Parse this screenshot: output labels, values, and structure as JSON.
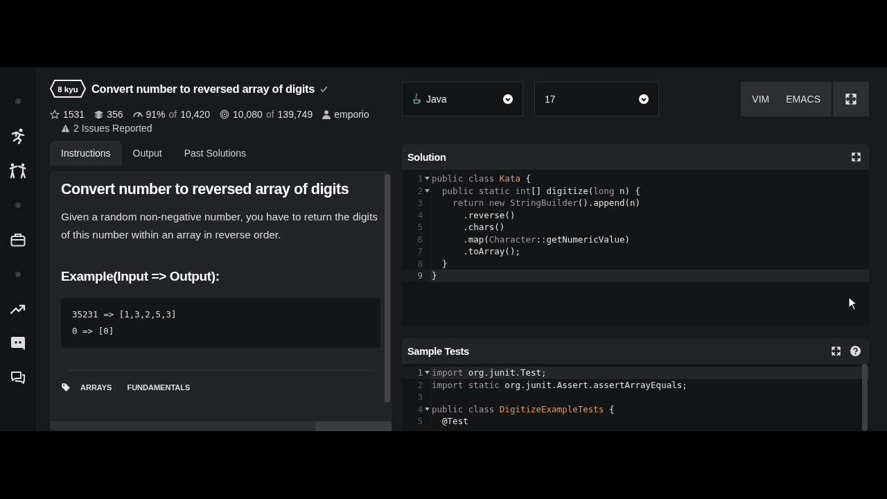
{
  "kata": {
    "rank": "8 kyu",
    "title": "Convert number to reversed array of digits",
    "completed": true,
    "stats": [
      {
        "kind": "stars",
        "text": "1531"
      },
      {
        "kind": "collections",
        "text": "356"
      },
      {
        "kind": "satisfaction",
        "text": "91%",
        "muted": "of",
        "total": "10,420"
      },
      {
        "kind": "completions",
        "text": "10,080",
        "muted": "of",
        "total": "139,749"
      },
      {
        "kind": "author",
        "text": "emporio"
      }
    ],
    "issues": "2 Issues Reported"
  },
  "tabs": [
    {
      "label": "Instructions",
      "selected": true
    },
    {
      "label": "Output",
      "selected": false
    },
    {
      "label": "Past Solutions",
      "selected": false
    }
  ],
  "description": {
    "heading": "Convert number to reversed array of digits",
    "paragraph": "Given a random non-negative number, you have to return the digits of this number within an array in reverse order.",
    "example_heading": "Example(Input => Output):",
    "example_lines": [
      "35231 => [1,3,2,5,3]",
      "0 => [0]"
    ],
    "tags": [
      "ARRAYS",
      "FUNDAMENTALS"
    ]
  },
  "toolbar": {
    "language": "Java",
    "version": "17",
    "modes": [
      "VIM",
      "EMACS"
    ]
  },
  "editors": [
    {
      "title": "Solution",
      "help": false,
      "lines": [
        {
          "number": "1",
          "foldable": true,
          "current": false,
          "tokens": [
            {
              "kind": "keyword",
              "text": "public class "
            },
            {
              "kind": "type",
              "text": "Kata"
            },
            {
              "kind": "plain",
              "text": " {"
            }
          ]
        },
        {
          "number": "2",
          "foldable": true,
          "current": false,
          "tokens": [
            {
              "kind": "keyword",
              "text": "  public static int"
            },
            {
              "kind": "plain",
              "text": "[] digitize("
            },
            {
              "kind": "keyword",
              "text": "long"
            },
            {
              "kind": "plain",
              "text": " n) {"
            }
          ]
        },
        {
          "number": "3",
          "foldable": false,
          "current": false,
          "tokens": [
            {
              "kind": "keyword",
              "text": "    return new StringBuilder"
            },
            {
              "kind": "plain",
              "text": "().append(n)"
            }
          ]
        },
        {
          "number": "4",
          "foldable": false,
          "current": false,
          "tokens": [
            {
              "kind": "plain",
              "text": "      .reverse()"
            }
          ]
        },
        {
          "number": "5",
          "foldable": false,
          "current": false,
          "tokens": [
            {
              "kind": "plain",
              "text": "      .chars()"
            }
          ]
        },
        {
          "number": "6",
          "foldable": false,
          "current": false,
          "tokens": [
            {
              "kind": "plain",
              "text": "      .map("
            },
            {
              "kind": "keyword",
              "text": "Character"
            },
            {
              "kind": "plain",
              "text": "::getNumericValue)"
            }
          ]
        },
        {
          "number": "7",
          "foldable": false,
          "current": false,
          "tokens": [
            {
              "kind": "plain",
              "text": "      .toArray();"
            }
          ]
        },
        {
          "number": "8",
          "foldable": false,
          "current": false,
          "tokens": [
            {
              "kind": "plain",
              "text": "  }"
            }
          ]
        },
        {
          "number": "9",
          "foldable": false,
          "current": true,
          "tokens": [
            {
              "kind": "plain",
              "text": "}"
            }
          ]
        }
      ]
    },
    {
      "title": "Sample Tests",
      "help": true,
      "lines": [
        {
          "number": "1",
          "foldable": true,
          "current": true,
          "tokens": [
            {
              "kind": "keyword",
              "text": "import"
            },
            {
              "kind": "plain",
              "text": " org.junit.Test;"
            }
          ]
        },
        {
          "number": "2",
          "foldable": false,
          "current": false,
          "tokens": [
            {
              "kind": "keyword",
              "text": "import static"
            },
            {
              "kind": "plain",
              "text": " org.junit.Assert.assertArrayEquals;"
            }
          ]
        },
        {
          "number": "3",
          "foldable": false,
          "current": false
        },
        {
          "number": "4",
          "foldable": true,
          "current": false,
          "tokens": [
            {
              "kind": "keyword",
              "text": "public class "
            },
            {
              "kind": "type",
              "text": "DigitizeExampleTests"
            },
            {
              "kind": "plain",
              "text": " {"
            }
          ]
        },
        {
          "number": "5",
          "foldable": false,
          "current": false,
          "tokens": [
            {
              "kind": "plain",
              "text": "  @Test"
            }
          ]
        }
      ]
    }
  ]
}
